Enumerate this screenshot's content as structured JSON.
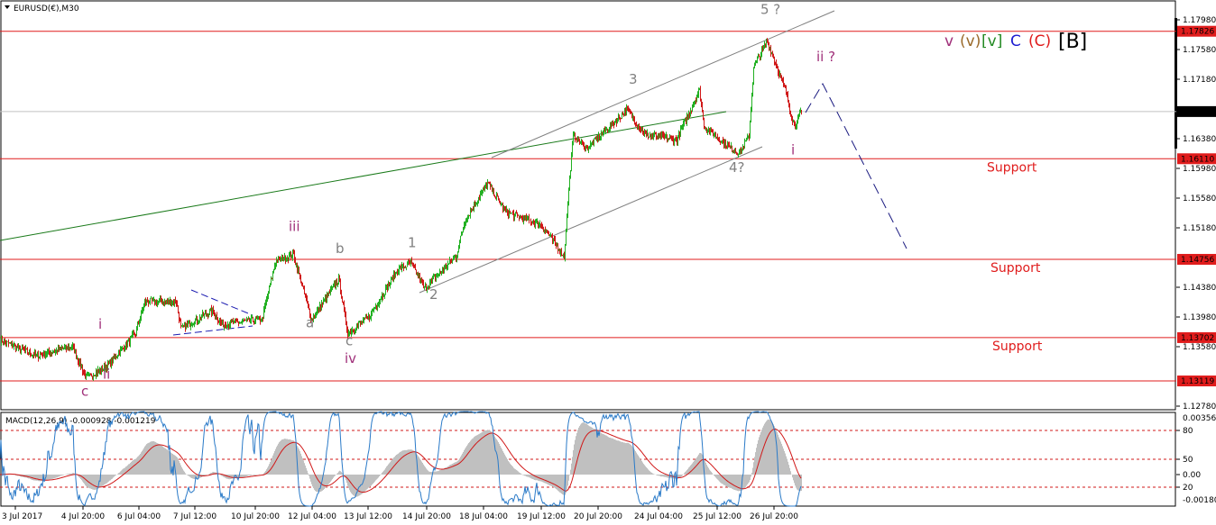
{
  "header": {
    "symbol_label": "EURUSD(€),M30"
  },
  "legend": [
    {
      "text": "v",
      "color": "#a0307a"
    },
    {
      "text": "(v)",
      "color": "#9a6a2a"
    },
    {
      "text": "[v]",
      "color": "#238a23"
    },
    {
      "text": "C",
      "color": "#1c1cd0"
    },
    {
      "text": "(C)",
      "color": "#e01c1c"
    },
    {
      "text": "[B]",
      "color": "#000000"
    }
  ],
  "colors": {
    "bull": "#22b022",
    "bear": "#d01818",
    "level": "#e01c1c",
    "trend": "#1a7a1a",
    "channel": "#808080",
    "projection": "#1a1a80",
    "wave_minor": "#a0307a",
    "wave_gray": "#808080",
    "macd_hist": "#c0c0c0",
    "macd_signal": "#d01818",
    "macd_main": "#2a7ac8"
  },
  "chart_data": {
    "type": "candlestick",
    "title": "EURUSD(€),M30",
    "ylim": [
      1.1274,
      1.1798
    ],
    "y_ticks": [
      "1.17980",
      "1.17580",
      "1.17180",
      "1.16380",
      "1.15980",
      "1.15580",
      "1.15180",
      "1.14380",
      "1.13980",
      "1.13580",
      "1.12780"
    ],
    "x_ticks": [
      "3 Jul 2017",
      "4 Jul 20:00",
      "6 Jul 04:00",
      "7 Jul 12:00",
      "10 Jul 20:00",
      "12 Jul 04:00",
      "13 Jul 12:00",
      "14 Jul 20:00",
      "18 Jul 04:00",
      "19 Jul 12:00",
      "20 Jul 20:00",
      "24 Jul 04:00",
      "25 Jul 12:00",
      "26 Jul 20:00"
    ],
    "x_tick_bars": [
      17,
      92,
      154,
      216,
      283,
      346,
      408,
      473,
      536,
      600,
      663,
      730,
      795,
      858
    ],
    "price_path": [
      [
        0,
        1.13665
      ],
      [
        40,
        1.13459
      ],
      [
        80,
        1.1358
      ],
      [
        95,
        1.13156
      ],
      [
        120,
        1.13338
      ],
      [
        150,
        1.13762
      ],
      [
        160,
        1.14186
      ],
      [
        195,
        1.14186
      ],
      [
        200,
        1.13822
      ],
      [
        235,
        1.14065
      ],
      [
        245,
        1.1388
      ],
      [
        290,
        1.13945
      ],
      [
        305,
        1.14731
      ],
      [
        325,
        1.14816
      ],
      [
        345,
        1.13944
      ],
      [
        375,
        1.14489
      ],
      [
        385,
        1.13762
      ],
      [
        410,
        1.14
      ],
      [
        440,
        1.1461
      ],
      [
        455,
        1.14707
      ],
      [
        470,
        1.14368
      ],
      [
        505,
        1.14792
      ],
      [
        515,
        1.15277
      ],
      [
        540,
        1.15786
      ],
      [
        560,
        1.15398
      ],
      [
        600,
        1.15216
      ],
      [
        625,
        1.14792
      ],
      [
        630,
        1.15702
      ],
      [
        635,
        1.16428
      ],
      [
        650,
        1.16246
      ],
      [
        695,
        1.16768
      ],
      [
        715,
        1.16428
      ],
      [
        750,
        1.16368
      ],
      [
        775,
        1.17035
      ],
      [
        780,
        1.1655
      ],
      [
        810,
        1.16246
      ],
      [
        820,
        1.16186
      ],
      [
        830,
        1.16428
      ],
      [
        835,
        1.17338
      ],
      [
        850,
        1.17701
      ],
      [
        870,
        1.1704
      ],
      [
        880,
        1.1655
      ],
      [
        888,
        1.16745
      ]
    ],
    "current_price": "1.16745",
    "levels": [
      {
        "price": 1.17826,
        "label": "1.17826",
        "note": ""
      },
      {
        "price": 1.1611,
        "label": "1.16110",
        "note": "Support"
      },
      {
        "price": 1.14756,
        "label": "1.14756",
        "note": "Support"
      },
      {
        "price": 1.13702,
        "label": "1.13702",
        "note": "Support"
      },
      {
        "price": 1.13119,
        "label": "1.13119",
        "note": ""
      }
    ],
    "wave_labels": [
      {
        "text": "5 ?",
        "bar": 843,
        "price": 1.1806,
        "color": "gray"
      },
      {
        "text": "3",
        "bar": 697,
        "price": 1.1712,
        "color": "gray"
      },
      {
        "text": "4?",
        "bar": 808,
        "price": 1.1593,
        "color": "gray"
      },
      {
        "text": "ii ?",
        "bar": 905,
        "price": 1.1742,
        "color": "minor"
      },
      {
        "text": "i",
        "bar": 877,
        "price": 1.1617,
        "color": "minor"
      },
      {
        "text": "iii",
        "bar": 320,
        "price": 1.1514,
        "color": "minor"
      },
      {
        "text": "1",
        "bar": 452,
        "price": 1.1492,
        "color": "gray"
      },
      {
        "text": "2",
        "bar": 476,
        "price": 1.1422,
        "color": "gray"
      },
      {
        "text": "b",
        "bar": 372,
        "price": 1.1484,
        "color": "gray"
      },
      {
        "text": "a",
        "bar": 339,
        "price": 1.1384,
        "color": "gray"
      },
      {
        "text": "c",
        "bar": 383,
        "price": 1.136,
        "color": "gray"
      },
      {
        "text": "iv",
        "bar": 382,
        "price": 1.1336,
        "color": "minor"
      },
      {
        "text": "i",
        "bar": 109,
        "price": 1.1382,
        "color": "minor"
      },
      {
        "text": "ii",
        "bar": 114,
        "price": 1.1315,
        "color": "minor"
      },
      {
        "text": "c",
        "bar": 90,
        "price": 1.1292,
        "color": "minor"
      }
    ],
    "macd": {
      "label": "MACD(12,26,9) -0.000928 -0.001219",
      "scale_top": "0.003568",
      "scale_bottom": "-0.001802",
      "levels": [
        "80",
        "50",
        "0.00",
        "20"
      ]
    }
  }
}
